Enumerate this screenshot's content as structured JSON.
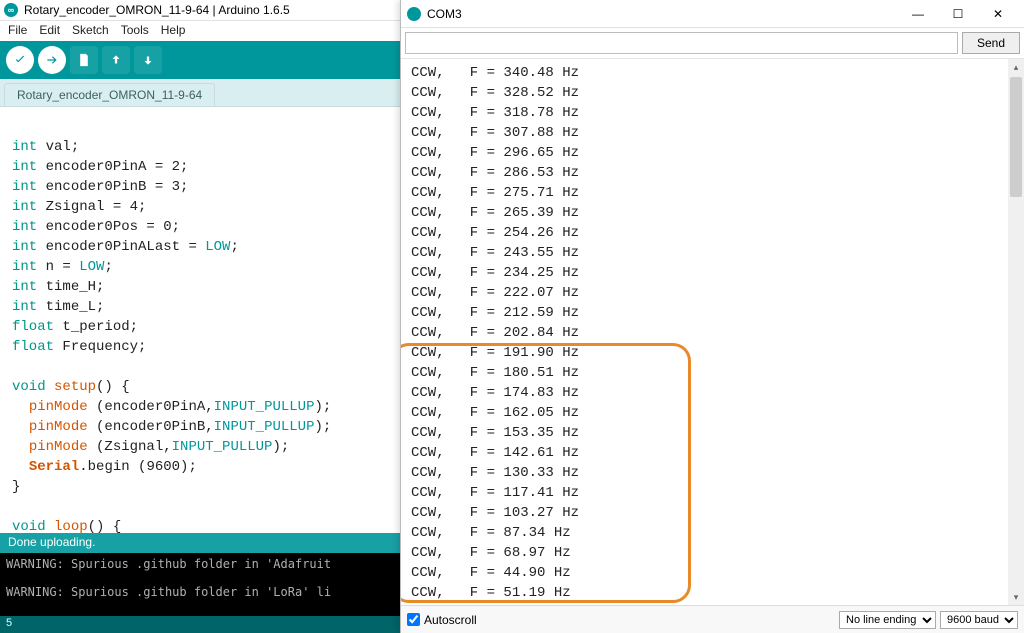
{
  "ide": {
    "title": "Rotary_encoder_OMRON_11-9-64 | Arduino 1.6.5",
    "menu": [
      "File",
      "Edit",
      "Sketch",
      "Tools",
      "Help"
    ],
    "tab": "Rotary_encoder_OMRON_11-9-64",
    "status": "Done uploading.",
    "console": "WARNING: Spurious .github folder in 'Adafruit\n\nWARNING: Spurious .github folder in 'LoRa' li",
    "footer": "5",
    "code": {
      "l1": "int",
      "l1b": " val;",
      "l2": "int",
      "l2b": " encoder0PinA = 2;",
      "l3": "int",
      "l3b": " encoder0PinB = 3;",
      "l4": "int",
      "l4b": " Zsignal = 4;",
      "l5": "int",
      "l5b": " encoder0Pos = 0;",
      "l6": "int",
      "l6b": " encoder0PinALast = ",
      "l6c": "LOW",
      "l6d": ";",
      "l7": "int",
      "l7b": " n = ",
      "l7c": "LOW",
      "l7d": ";",
      "l8": "int",
      "l8b": " time_H;",
      "l9": "int",
      "l9b": " time_L;",
      "l10": "float",
      "l10b": " t_period;",
      "l11": "float",
      "l11b": " Frequency;",
      "l12": "void",
      "l12b": " ",
      "l12c": "setup",
      "l12d": "() {",
      "l13a": "  ",
      "l13b": "pinMode",
      "l13c": " (encoder0PinA,",
      "l13d": "INPUT_PULLUP",
      "l13e": ");",
      "l14a": "  ",
      "l14b": "pinMode",
      "l14c": " (encoder0PinB,",
      "l14d": "INPUT_PULLUP",
      "l14e": ");",
      "l15a": "  ",
      "l15b": "pinMode",
      "l15c": " (Zsignal,",
      "l15d": "INPUT_PULLUP",
      "l15e": ");",
      "l16a": "  ",
      "l16b": "Serial",
      "l16c": ".begin (9600);",
      "l17": "}",
      "l18": "void",
      "l18b": " ",
      "l18c": "loop",
      "l18d": "() {"
    }
  },
  "serial": {
    "title": "COM3",
    "send": "Send",
    "autoscroll": "Autoscroll",
    "lineEnding": "No line ending",
    "baud": "9600 baud",
    "input": "",
    "lines": [
      "CCW,   F = 340.48 Hz",
      "CCW,   F = 328.52 Hz",
      "CCW,   F = 318.78 Hz",
      "CCW,   F = 307.88 Hz",
      "CCW,   F = 296.65 Hz",
      "CCW,   F = 286.53 Hz",
      "CCW,   F = 275.71 Hz",
      "CCW,   F = 265.39 Hz",
      "CCW,   F = 254.26 Hz",
      "CCW,   F = 243.55 Hz",
      "CCW,   F = 234.25 Hz",
      "CCW,   F = 222.07 Hz",
      "CCW,   F = 212.59 Hz",
      "CCW,   F = 202.84 Hz",
      "CCW,   F = 191.90 Hz",
      "CCW,   F = 180.51 Hz",
      "CCW,   F = 174.83 Hz",
      "CCW,   F = 162.05 Hz",
      "CCW,   F = 153.35 Hz",
      "CCW,   F = 142.61 Hz",
      "CCW,   F = 130.33 Hz",
      "CCW,   F = 117.41 Hz",
      "CCW,   F = 103.27 Hz",
      "CCW,   F = 87.34 Hz",
      "CCW,   F = 68.97 Hz",
      "CCW,   F = 44.90 Hz",
      "CCW,   F = 51.19 Hz"
    ]
  }
}
